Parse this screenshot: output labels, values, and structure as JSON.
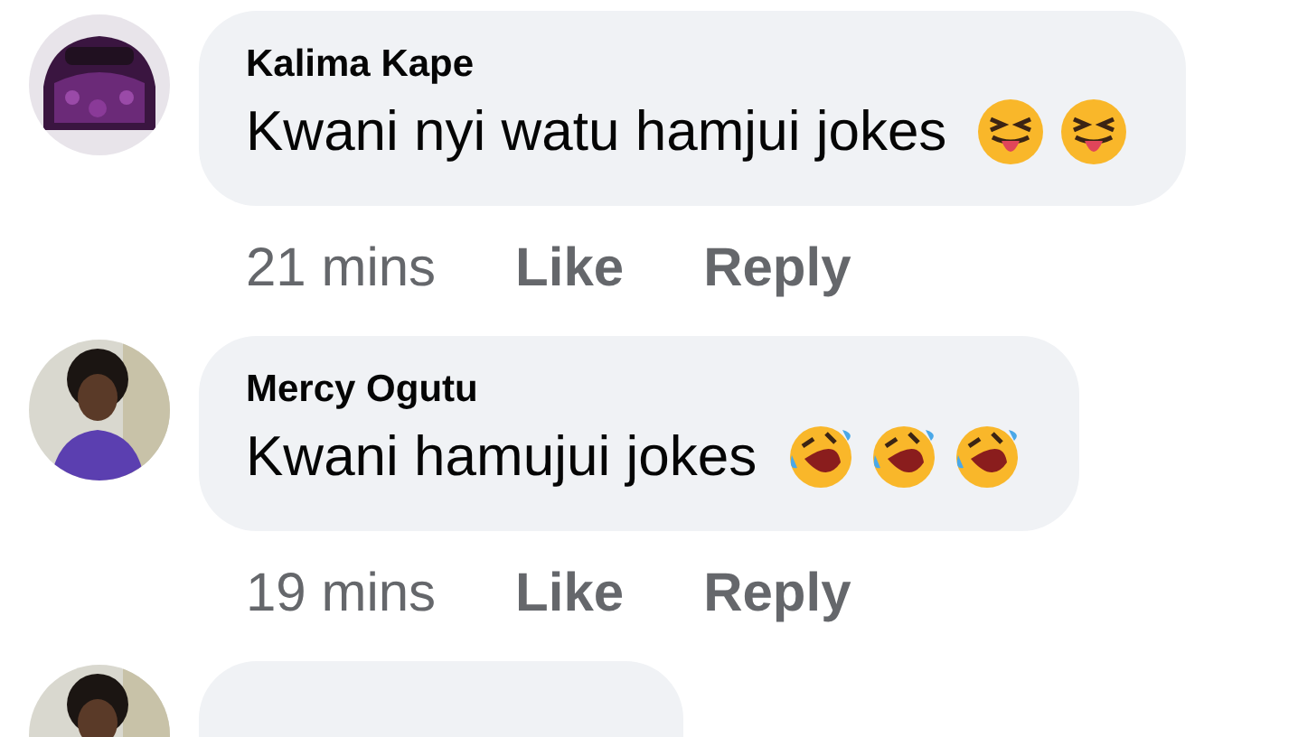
{
  "comments": [
    {
      "avatar": {
        "kind": "car"
      },
      "author": "Kalima Kape",
      "text": "Kwani nyi watu hamjui jokes",
      "emojis": [
        {
          "kind": "squint-tongue"
        },
        {
          "kind": "squint-tongue"
        }
      ],
      "time": "21 mins",
      "actions": [
        "Like",
        "Reply"
      ]
    },
    {
      "avatar": {
        "kind": "person"
      },
      "author": "Mercy Ogutu",
      "text": "Kwani hamujui jokes",
      "emojis": [
        {
          "kind": "rolling-laugh"
        },
        {
          "kind": "rolling-laugh"
        },
        {
          "kind": "rolling-laugh"
        }
      ],
      "time": "19 mins",
      "actions": [
        "Like",
        "Reply"
      ]
    },
    {
      "avatar": {
        "kind": "person"
      }
    }
  ]
}
